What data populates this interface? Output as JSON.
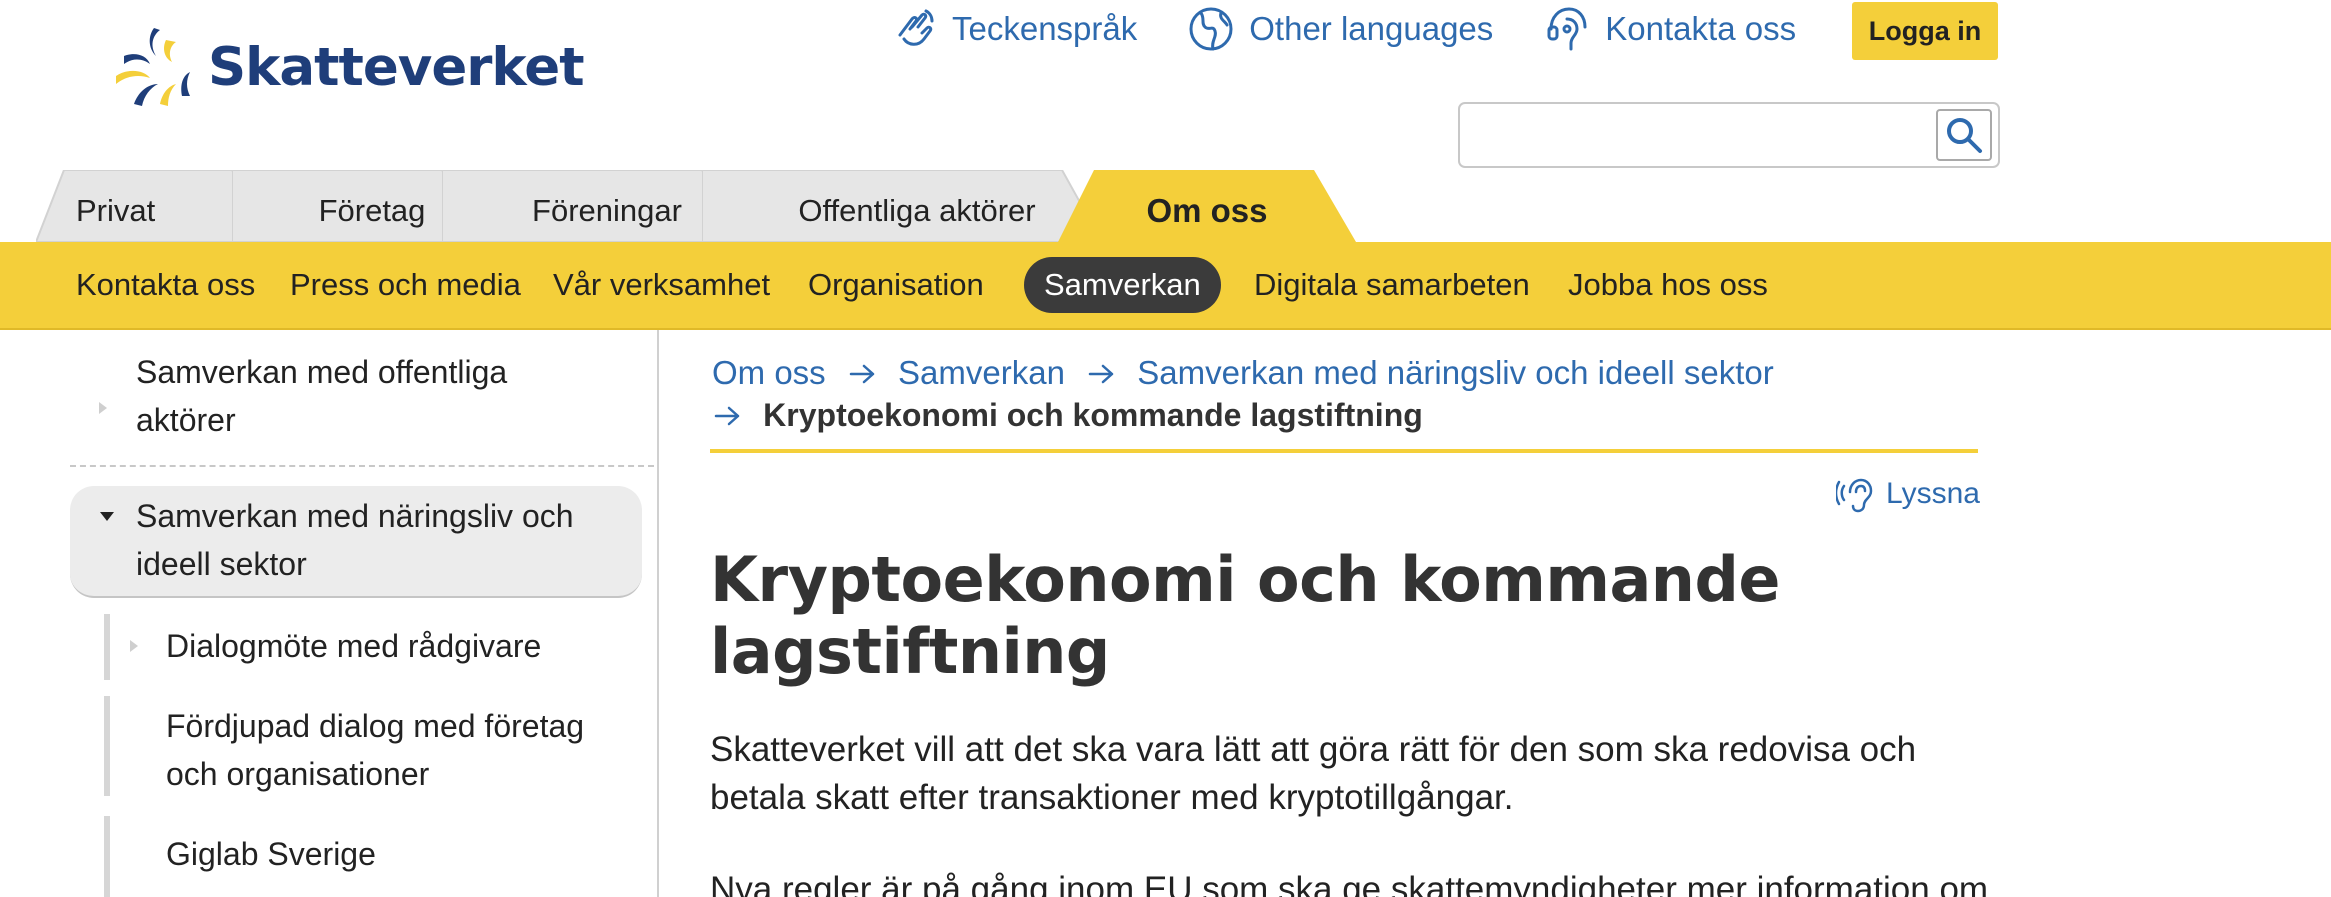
{
  "brand": {
    "name": "Skatteverket",
    "colors": {
      "navy": "#1f3e7a",
      "blue": "#2e6aae",
      "yellow": "#f4cf3a"
    }
  },
  "top_links": [
    {
      "label": "Teckenspråk",
      "icon": "sign-language-icon"
    },
    {
      "label": "Other languages",
      "icon": "globe-icon"
    },
    {
      "label": "Kontakta oss",
      "icon": "contact-headset-icon"
    }
  ],
  "login_label": "Logga in",
  "search": {
    "value": "",
    "placeholder": "",
    "icon": "search-icon"
  },
  "main_tabs": [
    {
      "label": "Privat",
      "active": false
    },
    {
      "label": "Företag",
      "active": false
    },
    {
      "label": "Föreningar",
      "active": false
    },
    {
      "label": "Offentliga aktörer",
      "active": false
    },
    {
      "label": "Om oss",
      "active": true
    }
  ],
  "sub_nav": [
    {
      "label": "Kontakta oss",
      "active": false
    },
    {
      "label": "Press och media",
      "active": false
    },
    {
      "label": "Vår verksamhet",
      "active": false
    },
    {
      "label": "Organisation",
      "active": false
    },
    {
      "label": "Samverkan",
      "active": true
    },
    {
      "label": "Digitala samarbeten",
      "active": false
    },
    {
      "label": "Jobba hos oss",
      "active": false
    }
  ],
  "left_nav": {
    "items": [
      {
        "label_lines": [
          "Samverkan med offentliga",
          "aktörer"
        ],
        "expanded": false
      },
      {
        "label_lines": [
          "Samverkan med näringsliv och",
          "ideell sektor"
        ],
        "expanded": true
      },
      {
        "label_lines": [
          "Dialogmöte med rådgivare"
        ],
        "has_children": true
      },
      {
        "label_lines": [
          "Fördjupad dialog med företag",
          "och organisationer"
        ],
        "has_children": false
      },
      {
        "label_lines": [
          "Giglab Sverige"
        ],
        "has_children": false
      }
    ]
  },
  "breadcrumb": {
    "links": [
      "Om oss",
      "Samverkan",
      "Samverkan med näringsliv och ideell sektor"
    ],
    "current": "Kryptoekonomi och kommande lagstiftning"
  },
  "listen_label": "Lyssna",
  "article": {
    "title_lines": [
      "Kryptoekonomi och kommande",
      "lagstiftning"
    ],
    "lead_lines": [
      "Skatteverket vill att det ska vara lätt att göra rätt för den som ska redovisa och",
      "betala skatt efter transaktioner med kryptotillgångar."
    ],
    "para_first_line": "Nya regler är på gång inom EU som ska ge skattemyndigheter mer information om"
  }
}
